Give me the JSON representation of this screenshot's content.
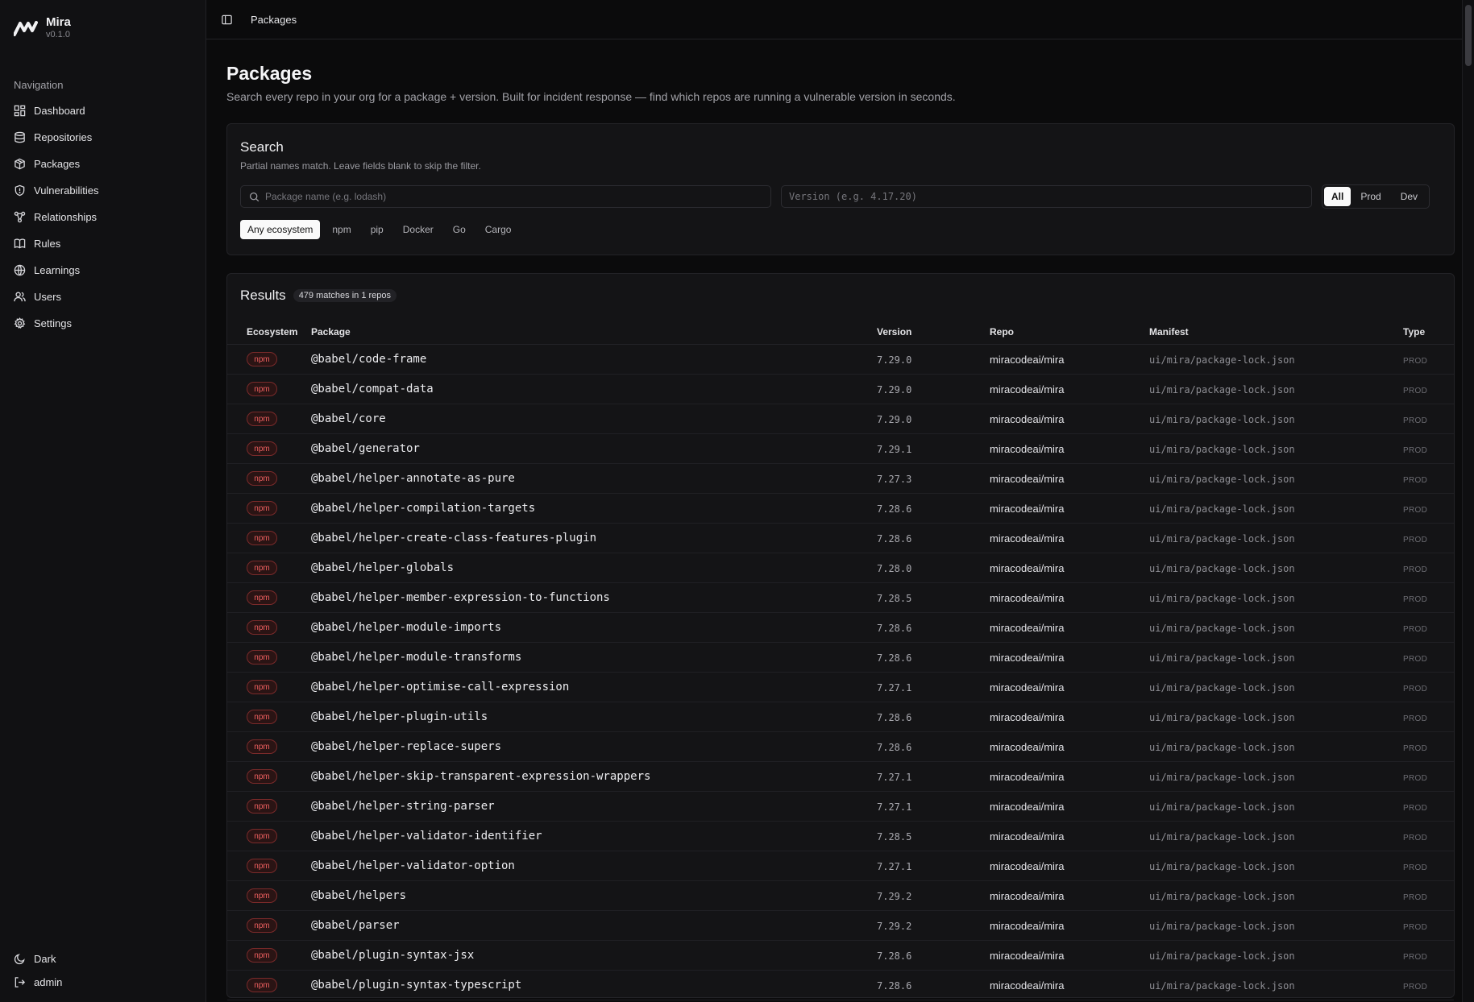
{
  "app": {
    "name": "Mira",
    "version": "v0.1.0"
  },
  "sidebar": {
    "heading": "Navigation",
    "items": [
      {
        "label": "Dashboard",
        "icon": "dashboard-icon"
      },
      {
        "label": "Repositories",
        "icon": "database-icon"
      },
      {
        "label": "Packages",
        "icon": "package-icon"
      },
      {
        "label": "Vulnerabilities",
        "icon": "shield-icon"
      },
      {
        "label": "Relationships",
        "icon": "graph-icon"
      },
      {
        "label": "Rules",
        "icon": "book-icon"
      },
      {
        "label": "Learnings",
        "icon": "globe-icon"
      },
      {
        "label": "Users",
        "icon": "users-icon"
      },
      {
        "label": "Settings",
        "icon": "gear-icon"
      }
    ],
    "theme_label": "Dark",
    "user_label": "admin"
  },
  "header": {
    "breadcrumb": "Packages"
  },
  "page": {
    "title": "Packages",
    "subtitle": "Search every repo in your org for a package + version. Built for incident response — find which repos are running a vulnerable version in seconds."
  },
  "search": {
    "title": "Search",
    "subtitle": "Partial names match. Leave fields blank to skip the filter.",
    "package_placeholder": "Package name (e.g. lodash)",
    "version_placeholder": "Version (e.g. 4.17.20)",
    "type_filters": [
      "All",
      "Prod",
      "Dev"
    ],
    "ecosystems": [
      "Any ecosystem",
      "npm",
      "pip",
      "Docker",
      "Go",
      "Cargo"
    ]
  },
  "results": {
    "title": "Results",
    "count_label": "479 matches in 1 repos",
    "columns": [
      "Ecosystem",
      "Package",
      "Version",
      "Repo",
      "Manifest",
      "Type"
    ],
    "rows": [
      {
        "eco": "npm",
        "pkg": "@babel/code-frame",
        "ver": "7.29.0",
        "repo": "miracodeai/mira",
        "man": "ui/mira/package-lock.json",
        "type": "PROD"
      },
      {
        "eco": "npm",
        "pkg": "@babel/compat-data",
        "ver": "7.29.0",
        "repo": "miracodeai/mira",
        "man": "ui/mira/package-lock.json",
        "type": "PROD"
      },
      {
        "eco": "npm",
        "pkg": "@babel/core",
        "ver": "7.29.0",
        "repo": "miracodeai/mira",
        "man": "ui/mira/package-lock.json",
        "type": "PROD"
      },
      {
        "eco": "npm",
        "pkg": "@babel/generator",
        "ver": "7.29.1",
        "repo": "miracodeai/mira",
        "man": "ui/mira/package-lock.json",
        "type": "PROD"
      },
      {
        "eco": "npm",
        "pkg": "@babel/helper-annotate-as-pure",
        "ver": "7.27.3",
        "repo": "miracodeai/mira",
        "man": "ui/mira/package-lock.json",
        "type": "PROD"
      },
      {
        "eco": "npm",
        "pkg": "@babel/helper-compilation-targets",
        "ver": "7.28.6",
        "repo": "miracodeai/mira",
        "man": "ui/mira/package-lock.json",
        "type": "PROD"
      },
      {
        "eco": "npm",
        "pkg": "@babel/helper-create-class-features-plugin",
        "ver": "7.28.6",
        "repo": "miracodeai/mira",
        "man": "ui/mira/package-lock.json",
        "type": "PROD"
      },
      {
        "eco": "npm",
        "pkg": "@babel/helper-globals",
        "ver": "7.28.0",
        "repo": "miracodeai/mira",
        "man": "ui/mira/package-lock.json",
        "type": "PROD"
      },
      {
        "eco": "npm",
        "pkg": "@babel/helper-member-expression-to-functions",
        "ver": "7.28.5",
        "repo": "miracodeai/mira",
        "man": "ui/mira/package-lock.json",
        "type": "PROD"
      },
      {
        "eco": "npm",
        "pkg": "@babel/helper-module-imports",
        "ver": "7.28.6",
        "repo": "miracodeai/mira",
        "man": "ui/mira/package-lock.json",
        "type": "PROD"
      },
      {
        "eco": "npm",
        "pkg": "@babel/helper-module-transforms",
        "ver": "7.28.6",
        "repo": "miracodeai/mira",
        "man": "ui/mira/package-lock.json",
        "type": "PROD"
      },
      {
        "eco": "npm",
        "pkg": "@babel/helper-optimise-call-expression",
        "ver": "7.27.1",
        "repo": "miracodeai/mira",
        "man": "ui/mira/package-lock.json",
        "type": "PROD"
      },
      {
        "eco": "npm",
        "pkg": "@babel/helper-plugin-utils",
        "ver": "7.28.6",
        "repo": "miracodeai/mira",
        "man": "ui/mira/package-lock.json",
        "type": "PROD"
      },
      {
        "eco": "npm",
        "pkg": "@babel/helper-replace-supers",
        "ver": "7.28.6",
        "repo": "miracodeai/mira",
        "man": "ui/mira/package-lock.json",
        "type": "PROD"
      },
      {
        "eco": "npm",
        "pkg": "@babel/helper-skip-transparent-expression-wrappers",
        "ver": "7.27.1",
        "repo": "miracodeai/mira",
        "man": "ui/mira/package-lock.json",
        "type": "PROD"
      },
      {
        "eco": "npm",
        "pkg": "@babel/helper-string-parser",
        "ver": "7.27.1",
        "repo": "miracodeai/mira",
        "man": "ui/mira/package-lock.json",
        "type": "PROD"
      },
      {
        "eco": "npm",
        "pkg": "@babel/helper-validator-identifier",
        "ver": "7.28.5",
        "repo": "miracodeai/mira",
        "man": "ui/mira/package-lock.json",
        "type": "PROD"
      },
      {
        "eco": "npm",
        "pkg": "@babel/helper-validator-option",
        "ver": "7.27.1",
        "repo": "miracodeai/mira",
        "man": "ui/mira/package-lock.json",
        "type": "PROD"
      },
      {
        "eco": "npm",
        "pkg": "@babel/helpers",
        "ver": "7.29.2",
        "repo": "miracodeai/mira",
        "man": "ui/mira/package-lock.json",
        "type": "PROD"
      },
      {
        "eco": "npm",
        "pkg": "@babel/parser",
        "ver": "7.29.2",
        "repo": "miracodeai/mira",
        "man": "ui/mira/package-lock.json",
        "type": "PROD"
      },
      {
        "eco": "npm",
        "pkg": "@babel/plugin-syntax-jsx",
        "ver": "7.28.6",
        "repo": "miracodeai/mira",
        "man": "ui/mira/package-lock.json",
        "type": "PROD"
      },
      {
        "eco": "npm",
        "pkg": "@babel/plugin-syntax-typescript",
        "ver": "7.28.6",
        "repo": "miracodeai/mira",
        "man": "ui/mira/package-lock.json",
        "type": "PROD"
      }
    ]
  }
}
